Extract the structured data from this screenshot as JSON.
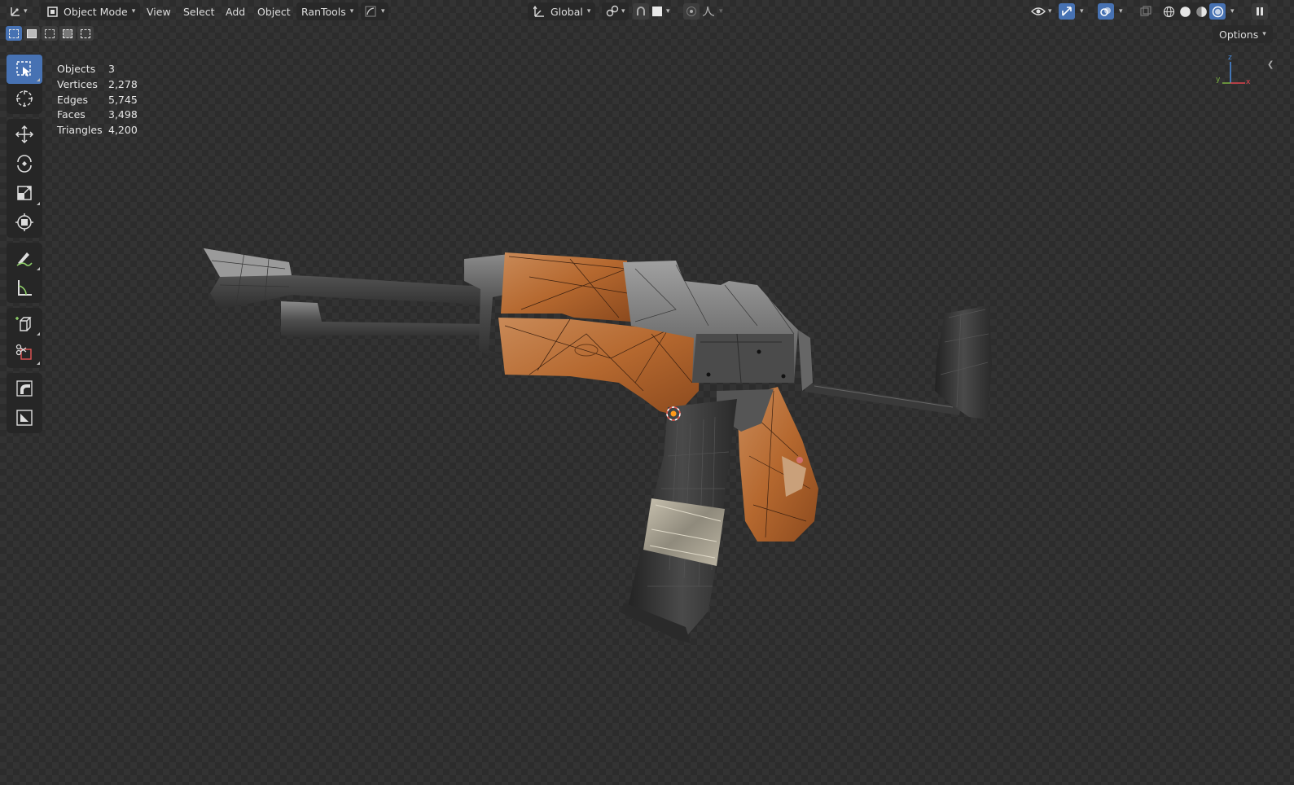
{
  "header": {
    "editor_type_icon": "axis-gizmo-icon",
    "mode": {
      "icon": "object-mode-icon",
      "label": "Object Mode"
    },
    "menus": [
      "View",
      "Select",
      "Add",
      "Object",
      "RanTools"
    ],
    "transform_orientation": {
      "icon": "transform-orientation-icon",
      "label": "Global"
    },
    "right_icons": [
      "visibility-eye-icon",
      "gizmo-icon",
      "overlays-icon",
      "xray-icon",
      "wireframe-shading-icon",
      "solid-shading-icon",
      "material-shading-icon",
      "rendered-shading-icon"
    ]
  },
  "options": {
    "label": "Options"
  },
  "toolbar": {
    "tools": [
      "select-box",
      "cursor",
      "move",
      "rotate",
      "scale",
      "transform",
      "annotate",
      "measure",
      "add-cube",
      "scissors",
      "bend",
      "shear"
    ]
  },
  "stats": {
    "rows": [
      {
        "label": "Objects",
        "value": "3"
      },
      {
        "label": "Vertices",
        "value": "2,278"
      },
      {
        "label": "Edges",
        "value": "5,745"
      },
      {
        "label": "Faces",
        "value": "3,498"
      },
      {
        "label": "Triangles",
        "value": "4,200"
      }
    ]
  },
  "gizmo": {
    "x": "x",
    "y": "y",
    "z": "z"
  },
  "colors": {
    "accent": "#4772b3",
    "wood": "#b5682f",
    "metal": "#4a4a4a",
    "axis_x": "#e0454f",
    "axis_y": "#7cb342",
    "axis_z": "#4a8de0"
  }
}
